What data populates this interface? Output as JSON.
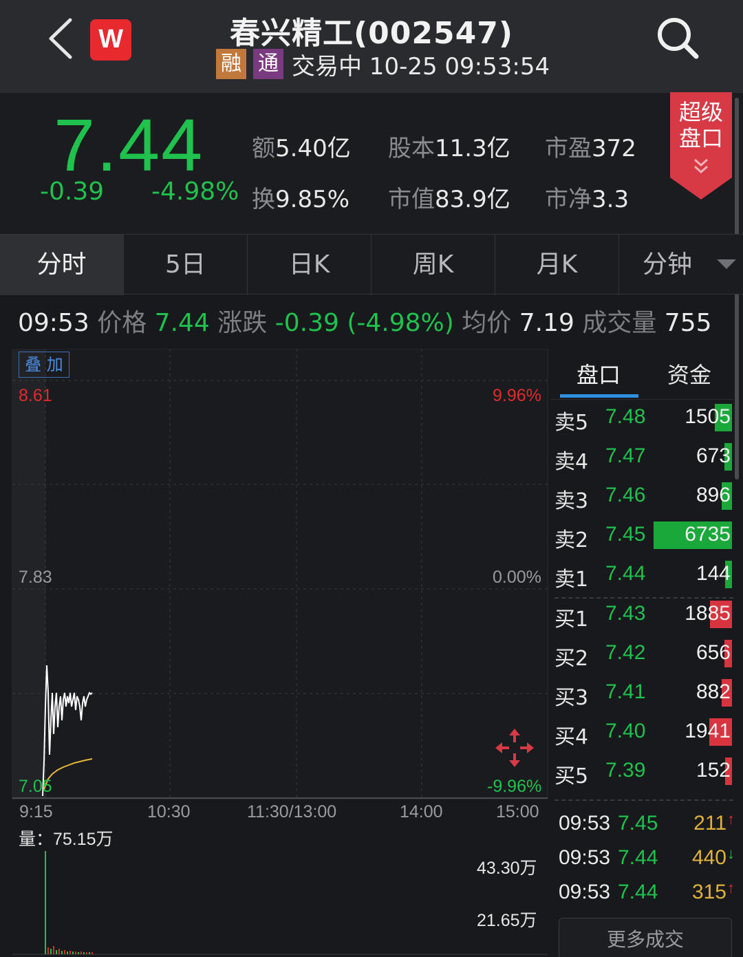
{
  "header": {
    "title": "春兴精工(002547)",
    "logo_letter": "W",
    "tag_rong": "融",
    "tag_tong": "通",
    "status": "交易中 10-25 09:53:54"
  },
  "quote": {
    "price": "7.44",
    "change": "-0.39",
    "change_pct": "-4.98%",
    "stats": [
      {
        "k": "额",
        "v": "5.40亿"
      },
      {
        "k": "股本",
        "v": "11.3亿"
      },
      {
        "k": "市盈",
        "v": "372"
      },
      {
        "k": "换",
        "v": "9.85%"
      },
      {
        "k": "市值",
        "v": "83.9亿"
      },
      {
        "k": "市净",
        "v": "3.3"
      }
    ],
    "super_badge_line1": "超级",
    "super_badge_line2": "盘口"
  },
  "tabs": [
    "分时",
    "5日",
    "日K",
    "周K",
    "月K",
    "分钟"
  ],
  "info": {
    "time": "09:53",
    "price_k": "价格",
    "price_v": "7.44",
    "chg_k": "涨跌",
    "chg_v": "-0.39 (-4.98%)",
    "avg_k": "均价",
    "avg_v": "7.19",
    "vol_k": "成交量",
    "vol_v": "755"
  },
  "chart": {
    "overlay": "叠 加",
    "y_top": "8.61",
    "y_mid": "7.83",
    "y_bot": "7.05",
    "pct_top": "9.96%",
    "pct_mid": "0.00%",
    "pct_bot": "-9.96%",
    "x_labels": [
      "9:15",
      "10:30",
      "11:30/13:00",
      "14:00",
      "15:00"
    ],
    "vol_label": "量：75.15万",
    "vol_mid": "43.30万",
    "vol_low": "21.65万",
    "colors": {
      "up": "#e02b2b",
      "down": "#1ec24c",
      "price_line": "#ffffff",
      "avg_line": "#e8b83a"
    }
  },
  "orderbook": {
    "tab_active": "盘口",
    "tab_other": "资金",
    "asks": [
      {
        "label": "卖5",
        "price": "7.48",
        "vol": "1505",
        "bar": 0.22
      },
      {
        "label": "卖4",
        "price": "7.47",
        "vol": "673",
        "bar": 0.1
      },
      {
        "label": "卖3",
        "price": "7.46",
        "vol": "896",
        "bar": 0.13
      },
      {
        "label": "卖2",
        "price": "7.45",
        "vol": "6735",
        "bar": 1.0
      },
      {
        "label": "卖1",
        "price": "7.44",
        "vol": "144",
        "bar": 0.02
      }
    ],
    "bids": [
      {
        "label": "买1",
        "price": "7.43",
        "vol": "1885",
        "bar": 0.28
      },
      {
        "label": "买2",
        "price": "7.42",
        "vol": "656",
        "bar": 0.1
      },
      {
        "label": "买3",
        "price": "7.41",
        "vol": "882",
        "bar": 0.13
      },
      {
        "label": "买4",
        "price": "7.40",
        "vol": "1941",
        "bar": 0.29
      },
      {
        "label": "买5",
        "price": "7.39",
        "vol": "152",
        "bar": 0.02
      }
    ],
    "ticks": [
      {
        "time": "09:53",
        "price": "7.45",
        "vol": "211",
        "dir": "↑",
        "dir_color": "#e02b2b"
      },
      {
        "time": "09:53",
        "price": "7.44",
        "vol": "440",
        "dir": "↓",
        "dir_color": "#1ec24c"
      },
      {
        "time": "09:53",
        "price": "7.44",
        "vol": "315",
        "dir": "↑",
        "dir_color": "#e02b2b"
      }
    ],
    "more": "更多成交"
  }
}
